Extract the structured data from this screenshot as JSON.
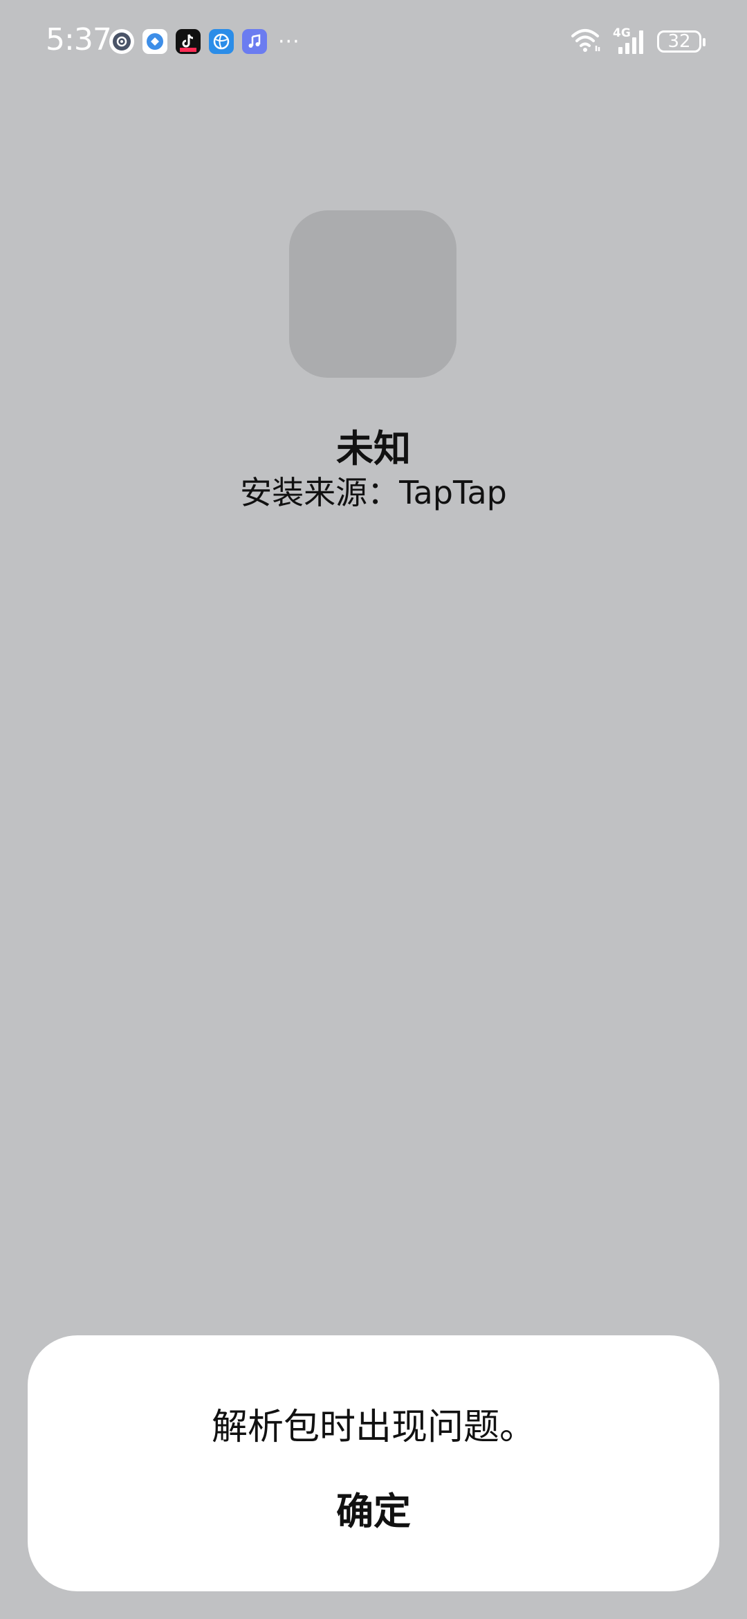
{
  "status_bar": {
    "time": "5:37",
    "notification_icons": [
      "settings-icon",
      "browser-icon",
      "tiktok-icon",
      "globe-icon",
      "music-icon"
    ],
    "more": "···",
    "network": "4G",
    "battery": "32"
  },
  "app": {
    "name": "未知",
    "install_source": "安装来源：TapTap"
  },
  "dialog": {
    "message": "解析包时出现问题。",
    "confirm_label": "确定"
  },
  "colors": {
    "background": "#c0c1c3",
    "placeholder_icon": "#abacae",
    "dialog": "#ffffff",
    "text": "#111111"
  }
}
